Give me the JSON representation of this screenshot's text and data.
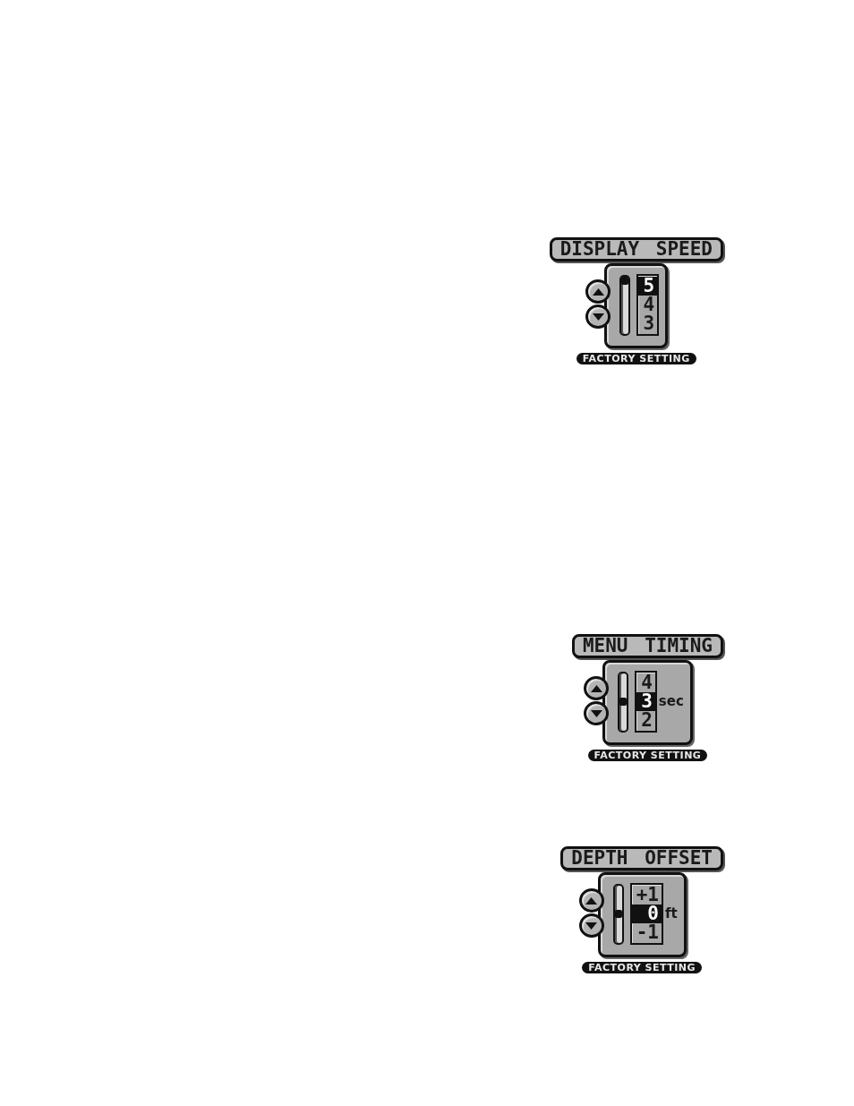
{
  "settings": [
    {
      "title": "DISPLAY SPEED",
      "slider": {
        "level": 1
      },
      "options": [
        {
          "label": "5",
          "selected": true
        },
        {
          "label": "4",
          "selected": false
        },
        {
          "label": "3",
          "selected": false
        }
      ],
      "factory_label": "FACTORY SETTING"
    },
    {
      "title": "MENU TIMING",
      "slider": {
        "level": 0.5
      },
      "options": [
        {
          "label": "4",
          "selected": false
        },
        {
          "label": "3",
          "selected": true
        },
        {
          "label": "2",
          "selected": false
        }
      ],
      "unit": "sec",
      "factory_label": "FACTORY SETTING"
    },
    {
      "title": "DEPTH OFFSET",
      "slider": {
        "level": 0.5
      },
      "options": [
        {
          "label": "+1",
          "selected": false
        },
        {
          "label": "0",
          "selected": true
        },
        {
          "label": "-1",
          "selected": false
        }
      ],
      "unit": "ft",
      "factory_label": "FACTORY SETTING"
    }
  ]
}
